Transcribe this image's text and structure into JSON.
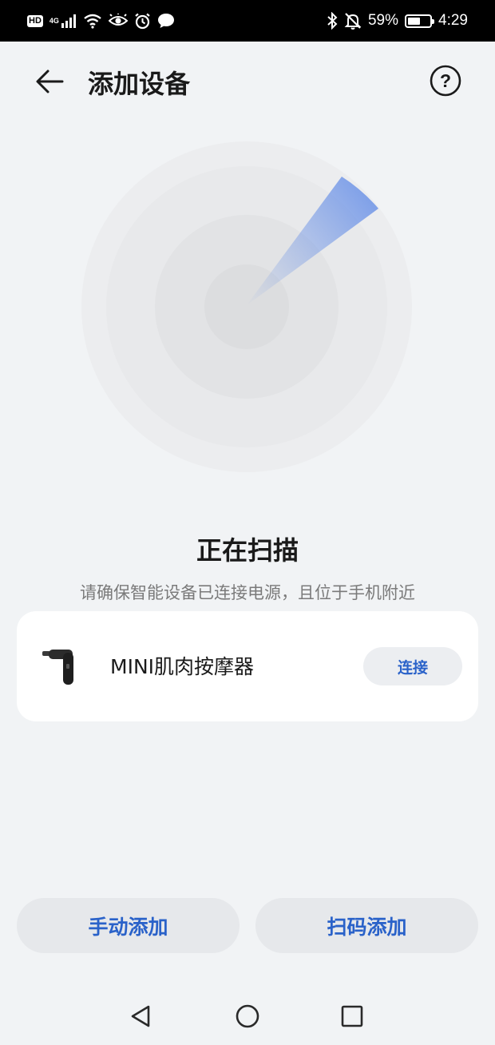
{
  "status_bar": {
    "hd": "HD",
    "network": "4G",
    "icons": [
      "hd-icon",
      "signal-icon",
      "wifi-icon",
      "eye-icon",
      "alarm-icon",
      "message-icon",
      "bluetooth-icon",
      "mute-icon",
      "battery-icon"
    ],
    "battery_percent": "59%",
    "battery_level": 0.59,
    "time": "4:29"
  },
  "header": {
    "title": "添加设备",
    "back_icon": "arrow-left-icon",
    "help_icon": "question-circle-icon",
    "help_glyph": "?"
  },
  "scan": {
    "title": "正在扫描",
    "hint": "请确保智能设备已连接电源，且位于手机附近"
  },
  "devices": [
    {
      "name": "MINI肌肉按摩器",
      "icon": "massage-gun-icon",
      "action_label": "连接"
    }
  ],
  "actions": {
    "manual_add": "手动添加",
    "scan_add": "扫码添加"
  },
  "nav": {
    "icons": [
      "nav-back-icon",
      "nav-home-icon",
      "nav-recent-icon"
    ]
  },
  "colors": {
    "accent": "#2a62c9",
    "background": "#f1f3f5",
    "card": "#ffffff",
    "radar_beam": "#5a86e6"
  }
}
